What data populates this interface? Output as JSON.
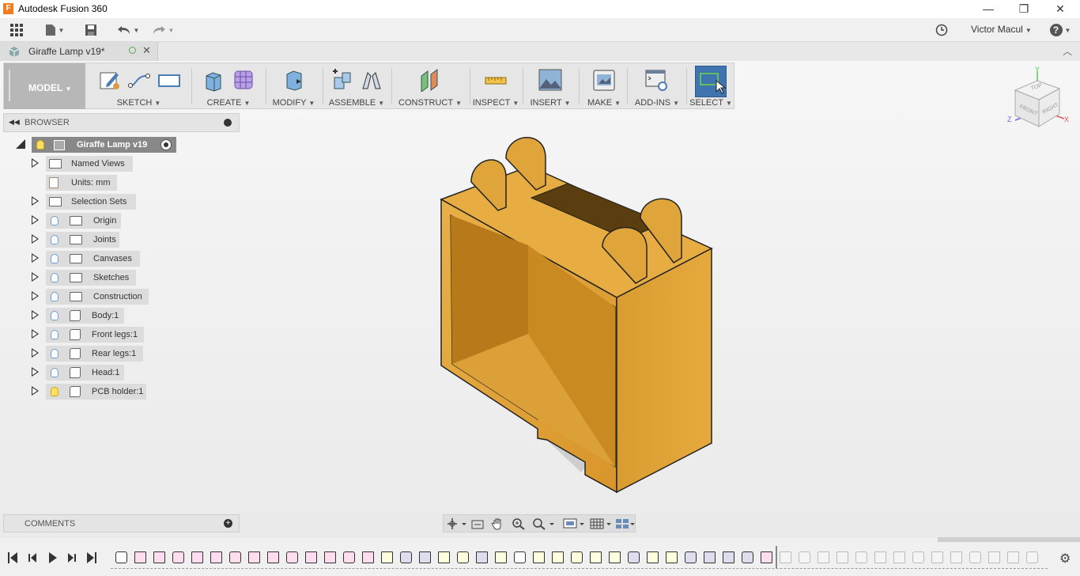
{
  "titlebar": {
    "app_title": "Autodesk Fusion 360",
    "app_icon": "F",
    "minimize": "—",
    "restore": "❐",
    "close": "✕"
  },
  "qat": {
    "user_name": "Victor Macul",
    "help": "?"
  },
  "document_tab": {
    "label": "Giraffe Lamp v19*"
  },
  "toolbar": {
    "workspace": "MODEL",
    "groups": [
      "SKETCH",
      "CREATE",
      "MODIFY",
      "ASSEMBLE",
      "CONSTRUCT",
      "INSPECT",
      "INSERT",
      "MAKE",
      "ADD-INS",
      "SELECT"
    ]
  },
  "browser": {
    "title": "BROWSER",
    "root": "Giraffe Lamp v19",
    "items": [
      {
        "label": "Named Views"
      },
      {
        "label": "Units: mm"
      },
      {
        "label": "Selection Sets"
      },
      {
        "label": "Origin"
      },
      {
        "label": "Joints"
      },
      {
        "label": "Canvases"
      },
      {
        "label": "Sketches"
      },
      {
        "label": "Construction"
      },
      {
        "label": "Body:1"
      },
      {
        "label": "Front legs:1"
      },
      {
        "label": "Rear legs:1"
      },
      {
        "label": "Head:1"
      },
      {
        "label": "PCB holder:1"
      }
    ]
  },
  "comments": {
    "title": "COMMENTS"
  },
  "viewcube": {
    "top": "TOP",
    "front": "FRONT",
    "right": "RIGHT",
    "x": "X",
    "y": "Y",
    "z": "Z"
  },
  "colors": {
    "accent": "#4a7cb5",
    "model_fill": "#e0a53a",
    "select_active": "#3f74b0"
  }
}
